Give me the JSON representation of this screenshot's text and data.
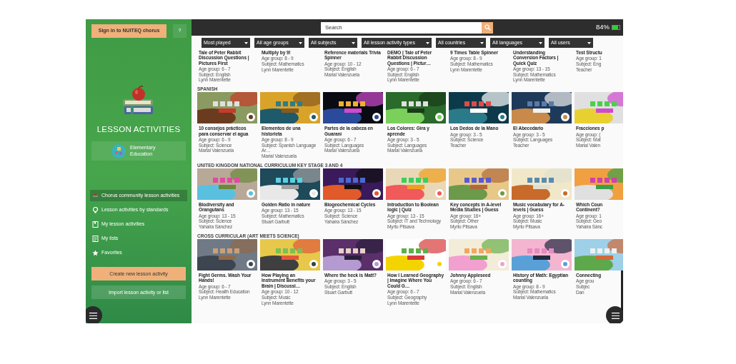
{
  "sidebar": {
    "sign_in_button": "Sign in to NUITEQ chorus",
    "help_button": "?",
    "title": "LESSON ACTIVITIES",
    "edition": "Elementary Education",
    "nav": [
      {
        "label": "Chorus community lesson activities",
        "selected": true
      },
      {
        "label": "Lesson activities by standards",
        "selected": false
      },
      {
        "label": "My lesson activities",
        "selected": false
      },
      {
        "label": "My lists",
        "selected": false
      },
      {
        "label": "Favorites",
        "selected": false
      }
    ],
    "create_button": "Create new lesson activity",
    "import_button": "Import lesson activity or list"
  },
  "search": {
    "placeholder": "Search"
  },
  "battery": {
    "reading": "84%",
    "level": 0.84
  },
  "filters": [
    "Most played",
    "All age groups",
    "All subjects",
    "All lesson activity types",
    "All countries",
    "All languages",
    "All users"
  ],
  "sections": [
    {
      "thumbnails": false,
      "cards": [
        {
          "title": "Tale of Peter Rabbit Discussion Questions | Pictures First",
          "age": "Age group: 6 - 7",
          "subject": "Subject: English",
          "author": "Lynn Marentette"
        },
        {
          "title": "Multiply by 9!",
          "age": "Age group: 8 - 9",
          "subject": "Subject: Mathematics",
          "author": "Lynn Marentette"
        },
        {
          "title": "Reference materials Trivia Spinner",
          "age": "Age group: 10 - 12",
          "subject": "Subject: English",
          "author": "Marial Valenzuela"
        },
        {
          "title": "DEMO | Tale of Peter Rabbit Discussion Questions | Pictur…",
          "age": "Age group: 6 - 7",
          "subject": "Subject: English",
          "author": "Lynn Marentette"
        },
        {
          "title": "9 Times Table Spinner",
          "age": "Age group: 8 - 9",
          "subject": "Subject: Mathematics",
          "author": "Lynn Marentette"
        },
        {
          "title": "Understanding Conversion Factors | Quick Quiz",
          "age": "Age group: 13 - 15",
          "subject": "Subject: Mathematics",
          "author": "Lynn Marentette"
        },
        {
          "title": "Test Structu",
          "age": "Age group: 1",
          "subject": "Subject: Eng",
          "author": "Teacher"
        }
      ]
    },
    {
      "heading": "SPANISH",
      "thumbnails": true,
      "cards": [
        {
          "title": "10 consejos prácticos para conservar el agua",
          "age": "Age group: 6 - 9",
          "subject": "Subject: Science",
          "author": "Marial Valenzuela"
        },
        {
          "title": "Elementos de una historieta",
          "age": "Age group: 8 - 9",
          "subject": "Subject: Spanish Language Ar…",
          "author": "Marial Valenzuela"
        },
        {
          "title": "Partes de la cabeza en Guaraní",
          "age": "Age group: 6 - 7",
          "subject": "Subject: Languages",
          "author": "Marial Valenzuela"
        },
        {
          "title": "Los Colores: Gira y aprende",
          "age": "Age group: 3 - 5",
          "subject": "Subject: Languages",
          "author": "Marial Valenzuela"
        },
        {
          "title": "Los Dedos de la Mano",
          "age": "Age group: 3 - 5",
          "subject": "Subject: Science",
          "author": "Teacher"
        },
        {
          "title": "El Abecedario",
          "age": "Age group: 3 - 5",
          "subject": "Subject: Languages",
          "author": "Teacher"
        },
        {
          "title": "Fracciones p",
          "age": "Age group: (",
          "subject": "Subject: Mat",
          "author": "Marial Valen"
        }
      ]
    },
    {
      "heading": "UNITED KINGDOM NATIONAL CURRICULUM KEY STAGE 3 AND 4",
      "thumbnails": true,
      "cards": [
        {
          "title": "Biodiversity and Orangutans",
          "age": "Age group: 13 - 15",
          "subject": "Subject: Science",
          "author": "Yahaira Sánchez"
        },
        {
          "title": "Golden Ratio in nature",
          "age": "Age group: 13 - 15",
          "subject": "Subject: Mathematics",
          "author": "Stuart Garbutt"
        },
        {
          "title": "Biogeochemical Cycles",
          "age": "Age group: 13 - 15",
          "subject": "Subject: Science",
          "author": "Yahaira Sánchez"
        },
        {
          "title": "Introduction to Boolean logic | Quiz",
          "age": "Age group: 13 - 15",
          "subject": "Subject: IT and Technology",
          "author": "Myrto Pitsava"
        },
        {
          "title": "Key concepts in A-level Media Studies | Guess",
          "age": "Age group: 16+",
          "subject": "Subject: Other",
          "author": "Myrto Pitsava"
        },
        {
          "title": "Music vocabulary for A-levels | Guess",
          "age": "Age group: 16+",
          "subject": "Subject: Music",
          "author": "Myrto Pitsava"
        },
        {
          "title": "Which Coun Continent?",
          "age": "Age group: 1",
          "subject": "Subject: Geo",
          "author": "Yahaira Sánc"
        }
      ]
    },
    {
      "heading": "CROSS CURRICULAR (ART MEETS SCIENCE)",
      "thumbnails": true,
      "cards": [
        {
          "title": "Fight Germs. Wash Your Hands!",
          "age": "Age group: 6 - 7",
          "subject": "Subject: Health Education",
          "author": "Lynn Marentette"
        },
        {
          "title": "How Playing an Instrument Benefits your Brain | Discussi…",
          "age": "Age group: 10 - 12",
          "subject": "Subject: Music",
          "author": "Lynn Marentette"
        },
        {
          "title": "Where the heck is Matt?",
          "age": "Age group: 3 - 5",
          "subject": "Subject: English",
          "author": "Stuart Garbutt"
        },
        {
          "title": "How I Learned Geography | Imagine Where You Could G…",
          "age": "Age group: 6 - 7",
          "subject": "Subject: Geography",
          "author": "Lynn Marentette"
        },
        {
          "title": "Johnny Appleseed",
          "age": "Age group: 6 - 7",
          "subject": "Subject: English",
          "author": "Marial Valenzuela"
        },
        {
          "title": "History of Math: Egyptian counting",
          "age": "Age group: 8 - 9",
          "subject": "Subject: Mathematics",
          "author": "Marial Valenzuela"
        },
        {
          "title": "Connecting",
          "age": "Age grou",
          "subject": "Subjec",
          "author": "Dan"
        }
      ]
    }
  ]
}
